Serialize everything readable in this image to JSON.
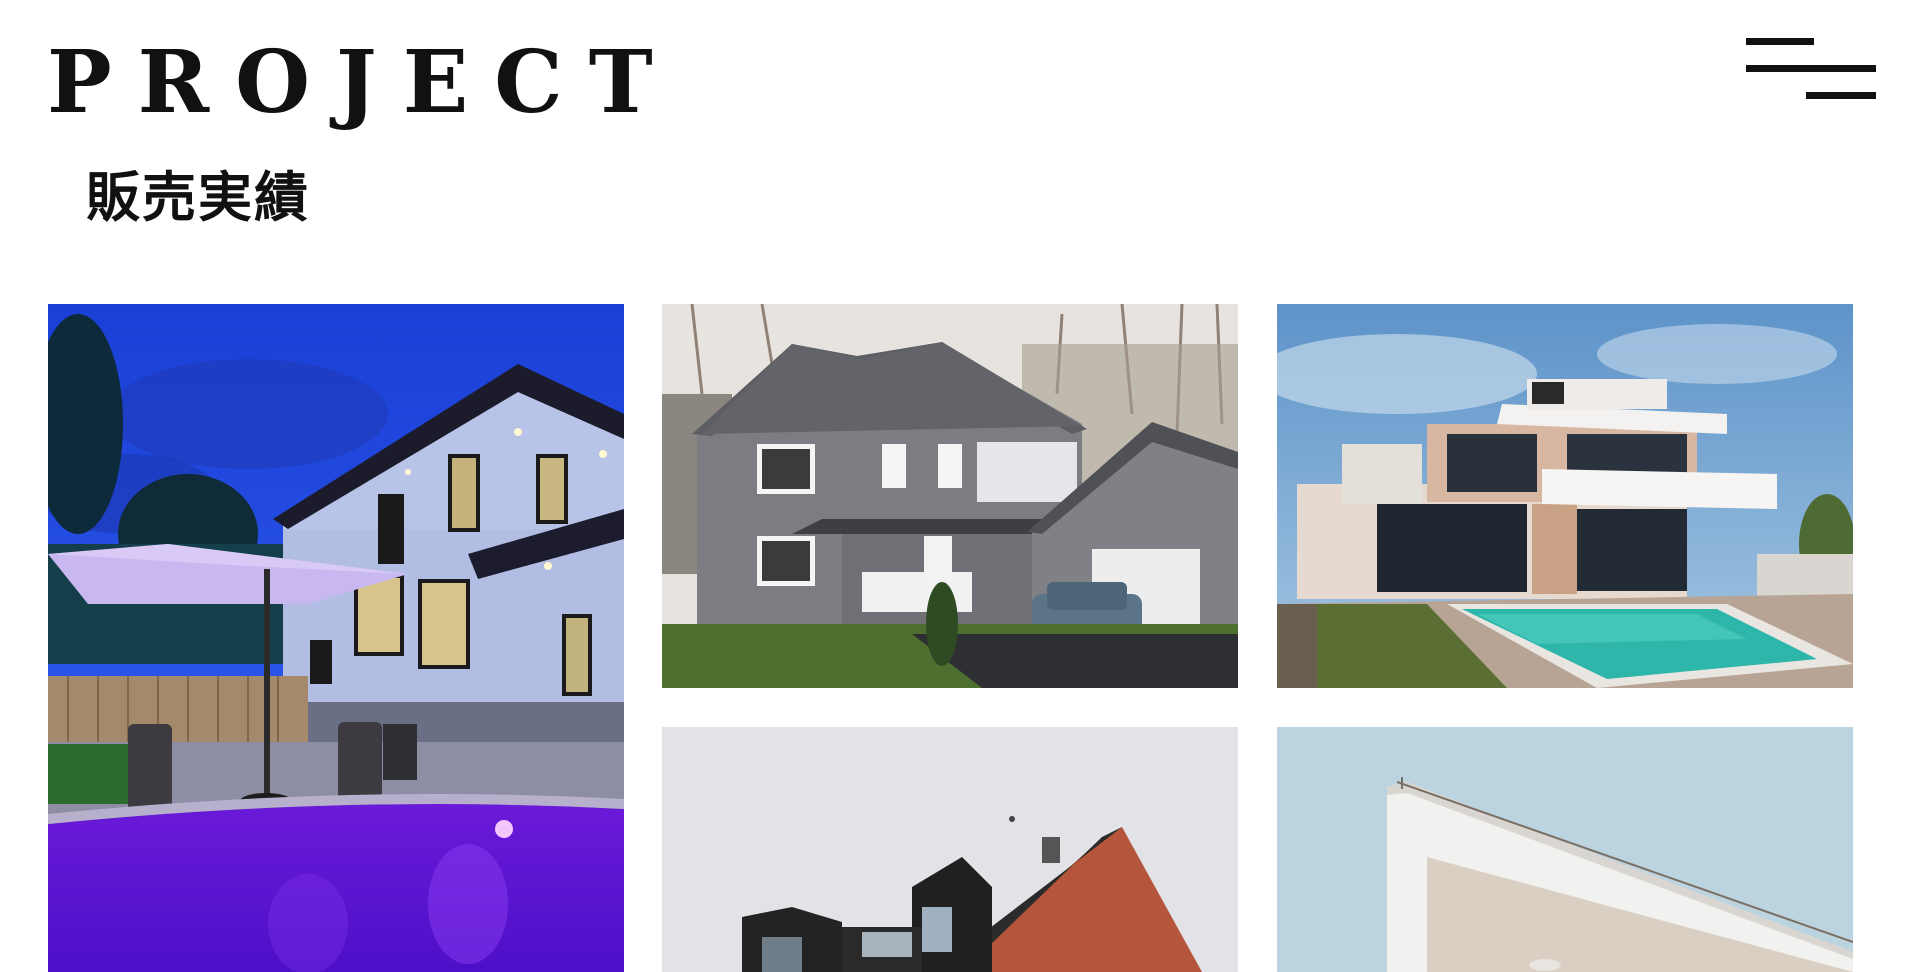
{
  "header": {
    "title": "PROJECT",
    "subtitle": "販売実績"
  },
  "menu": {
    "icon": "hamburger-menu-icon"
  },
  "projects": [
    {
      "name": "project-photo-night-house-pool"
    },
    {
      "name": "project-photo-stone-house-garage"
    },
    {
      "name": "project-photo-modern-villa-pool"
    },
    {
      "name": "project-photo-brick-apartment"
    },
    {
      "name": "project-photo-white-building-roof"
    }
  ]
}
